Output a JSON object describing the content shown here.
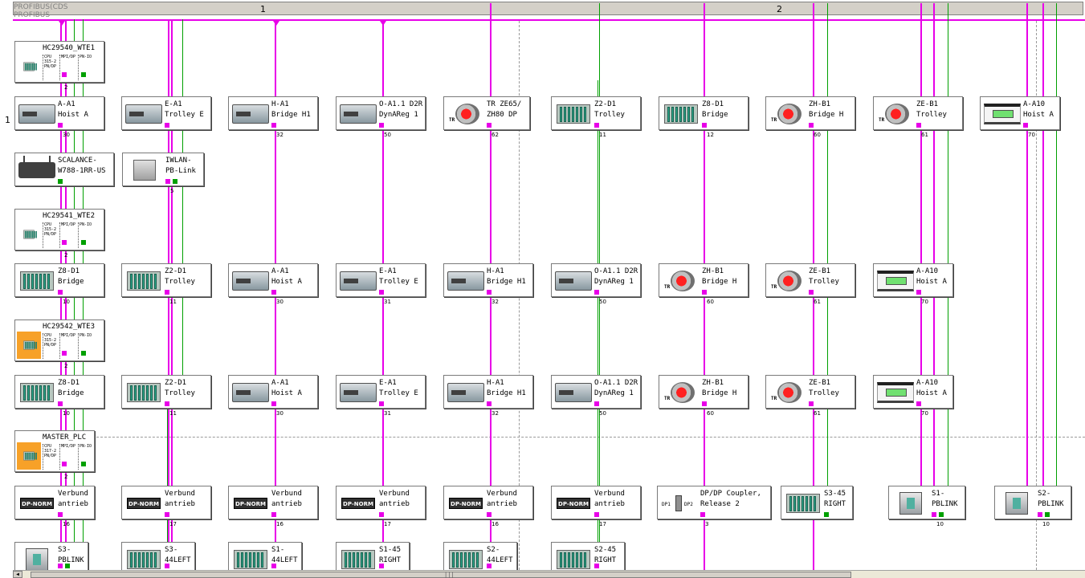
{
  "ruler": {
    "col1": "1",
    "col2": "2"
  },
  "bus_labels": [
    "PROFIBUS(CDS",
    "PROFIBUS"
  ],
  "row_number": "1",
  "stations": [
    {
      "id": "hc1",
      "kind": "plc",
      "title": "HC29540_WTE1",
      "cells": [
        "CPU\n315-2\nPN/DP",
        "MPI/DP",
        "PN-IO"
      ],
      "addr": "2"
    },
    {
      "id": "r1c0",
      "icon": "drive",
      "line1": "A-A1",
      "line2": "Hoist A",
      "addr": "30"
    },
    {
      "id": "r1c1",
      "icon": "drive",
      "line1": "E-A1",
      "line2": "Trolley E",
      "addr": ""
    },
    {
      "id": "r1c2",
      "icon": "drive",
      "line1": "H-A1",
      "line2": "Bridge H1",
      "addr": "32"
    },
    {
      "id": "r1c3",
      "icon": "drive",
      "line1": "O-A1.1 D2R",
      "line2": "DynAReg 1",
      "addr": "50"
    },
    {
      "id": "r1c4",
      "icon": "encoder",
      "line1": "TR ZE65/",
      "line2": "ZH80 DP",
      "addr": "62"
    },
    {
      "id": "r1c5",
      "icon": "rack",
      "line1": "Z2-D1",
      "line2": "Trolley",
      "addr": "11"
    },
    {
      "id": "r1c6",
      "icon": "rack",
      "line1": "Z8-D1",
      "line2": "Bridge",
      "addr": "12"
    },
    {
      "id": "r1c7",
      "icon": "encoder",
      "line1": "ZH-B1",
      "line2": "Bridge H",
      "addr": "60"
    },
    {
      "id": "r1c8",
      "icon": "encoder",
      "line1": "ZE-B1",
      "line2": "Trolley",
      "addr": "61"
    },
    {
      "id": "r1c9",
      "icon": "panel",
      "line1": "A-A10",
      "line2": "Hoist A",
      "addr": "70"
    },
    {
      "id": "r2c0",
      "icon": "scalance",
      "line1": "SCALANCE-",
      "line2": "W788-1RR-US",
      "addr": ""
    },
    {
      "id": "r2c1",
      "icon": "iwlan",
      "line1": "IWLAN-",
      "line2": "PB-Link",
      "addr": "5"
    },
    {
      "id": "hc2",
      "kind": "plc",
      "title": "HC29541_WTE2",
      "cells": [
        "CPU\n315-2\nPN/DP",
        "MPI/DP",
        "PN-IO"
      ],
      "addr": "2"
    },
    {
      "id": "r3c0",
      "icon": "rack",
      "line1": "Z8-D1",
      "line2": "Bridge",
      "addr": "10"
    },
    {
      "id": "r3c1",
      "icon": "rack",
      "line1": "Z2-D1",
      "line2": "Trolley",
      "addr": "11"
    },
    {
      "id": "r3c2",
      "icon": "drive",
      "line1": "A-A1",
      "line2": "Hoist A",
      "addr": "30"
    },
    {
      "id": "r3c3",
      "icon": "drive",
      "line1": "E-A1",
      "line2": "Trolley E",
      "addr": "31"
    },
    {
      "id": "r3c4",
      "icon": "drive",
      "line1": "H-A1",
      "line2": "Bridge H1",
      "addr": "32"
    },
    {
      "id": "r3c5",
      "icon": "drive",
      "line1": "O-A1.1 D2R",
      "line2": "DynAReg 1",
      "addr": "50"
    },
    {
      "id": "r3c6",
      "icon": "encoder",
      "line1": "ZH-B1",
      "line2": "Bridge H",
      "addr": "60"
    },
    {
      "id": "r3c7",
      "icon": "encoder",
      "line1": "ZE-B1",
      "line2": "Trolley",
      "addr": "61"
    },
    {
      "id": "r3c8",
      "icon": "panel",
      "line1": "A-A10",
      "line2": "Hoist A",
      "addr": "70"
    },
    {
      "id": "hc3",
      "kind": "plc",
      "orange": true,
      "title": "HC29542_WTE3",
      "cells": [
        "CPU\n315-2\nPN/DP",
        "MPI/DP",
        "PN-IO"
      ],
      "addr": "2"
    },
    {
      "id": "r4c0",
      "icon": "rack",
      "line1": "Z8-D1",
      "line2": "Bridge",
      "addr": "10"
    },
    {
      "id": "r4c1",
      "icon": "rack",
      "line1": "Z2-D1",
      "line2": "Trolley",
      "addr": "11"
    },
    {
      "id": "r4c2",
      "icon": "drive",
      "line1": "A-A1",
      "line2": "Hoist A",
      "addr": "30"
    },
    {
      "id": "r4c3",
      "icon": "drive",
      "line1": "E-A1",
      "line2": "Trolley E",
      "addr": "31"
    },
    {
      "id": "r4c4",
      "icon": "drive",
      "line1": "H-A1",
      "line2": "Bridge H1",
      "addr": "32"
    },
    {
      "id": "r4c5",
      "icon": "drive",
      "line1": "O-A1.1 D2R",
      "line2": "DynAReg 1",
      "addr": "50"
    },
    {
      "id": "r4c6",
      "icon": "encoder",
      "line1": "ZH-B1",
      "line2": "Bridge H",
      "addr": "60"
    },
    {
      "id": "r4c7",
      "icon": "encoder",
      "line1": "ZE-B1",
      "line2": "Trolley",
      "addr": "61"
    },
    {
      "id": "r4c8",
      "icon": "panel",
      "line1": "A-A10",
      "line2": "Hoist A",
      "addr": "70"
    },
    {
      "id": "master",
      "kind": "plc",
      "orange": true,
      "title": "MASTER_PLC",
      "cells": [
        "CPU\n317-2\nPN/DP",
        "MPI/DP",
        "PN-IO"
      ],
      "addr": "2"
    },
    {
      "id": "r5c0",
      "icon": "dpnorm",
      "line1": "Verbund",
      "line2": "antrieb",
      "addr": "16"
    },
    {
      "id": "r5c1",
      "icon": "dpnorm",
      "line1": "Verbund",
      "line2": "antrieb",
      "addr": "17"
    },
    {
      "id": "r5c2",
      "icon": "dpnorm",
      "line1": "Verbund",
      "line2": "antrieb",
      "addr": "16"
    },
    {
      "id": "r5c3",
      "icon": "dpnorm",
      "line1": "Verbund",
      "line2": "antrieb",
      "addr": "17"
    },
    {
      "id": "r5c4",
      "icon": "dpnorm",
      "line1": "Verbund",
      "line2": "antrieb",
      "addr": "16"
    },
    {
      "id": "r5c5",
      "icon": "dpnorm",
      "line1": "Verbund",
      "line2": "antrieb",
      "addr": "17"
    },
    {
      "id": "r5c6",
      "icon": "coupler",
      "line1": "DP/DP Coupler,",
      "line2": " Release 2",
      "addr": "3"
    },
    {
      "id": "r5c7",
      "icon": "rack",
      "line1": "S3-45",
      "line2": "RIGHT",
      "addr": ""
    },
    {
      "id": "r5c8",
      "icon": "pblink",
      "line1": "S1-",
      "line2": "PBLINK",
      "addr": "10"
    },
    {
      "id": "r5c9",
      "icon": "pblink",
      "line1": "S2-",
      "line2": "PBLINK",
      "addr": "10"
    },
    {
      "id": "r6c0",
      "icon": "pblink",
      "line1": "S3-",
      "line2": "PBLINK",
      "addr": ""
    },
    {
      "id": "r6c1",
      "icon": "rack",
      "line1": "S3-",
      "line2": "44LEFT",
      "addr": ""
    },
    {
      "id": "r6c2",
      "icon": "rack",
      "line1": "S1-",
      "line2": "44LEFT",
      "addr": ""
    },
    {
      "id": "r6c3",
      "icon": "rack",
      "line1": "S1-45",
      "line2": "RIGHT",
      "addr": ""
    },
    {
      "id": "r6c4",
      "icon": "rack",
      "line1": "S2-",
      "line2": "44LEFT",
      "addr": ""
    },
    {
      "id": "r6c5",
      "icon": "rack",
      "line1": "S2-45",
      "line2": "RIGHT",
      "addr": ""
    }
  ],
  "colors": {
    "bus_magenta": "#e800e8",
    "bus_green": "#00a000",
    "plc_orange": "#f7a128",
    "ruler_gray": "#d4d0c8"
  }
}
